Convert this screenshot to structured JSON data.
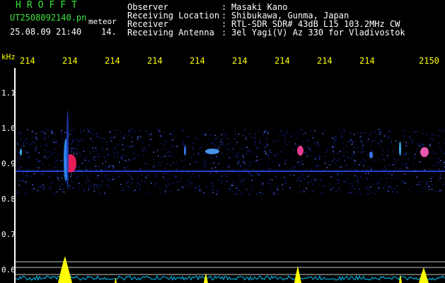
{
  "header": {
    "logo": "HROFFT",
    "filename": "UT2508092140.pn",
    "mode": "meteor",
    "timestamp": "25.08.09 21:40",
    "count": "14.",
    "fields": [
      {
        "label": "Observer",
        "value": "Masaki Kano"
      },
      {
        "label": "Receiving Location",
        "value": "Shibukawa, Gunma, Japan"
      },
      {
        "label": "Receiver",
        "value": "RTL-SDR SDR# 43dB L15 103.2MHz CW"
      },
      {
        "label": "Receiving Antenna",
        "value": "3el Yagi(V) Az 330 for Vladivostok"
      }
    ],
    "colon": ":"
  },
  "axes": {
    "y_unit": "kHz",
    "x_ticks": [
      "214",
      "214",
      "214",
      "214",
      "214",
      "214",
      "214",
      "214",
      "214",
      "2150"
    ],
    "y_ticks": [
      "1.1",
      "1.0",
      "0.9",
      "0.8",
      "0.7",
      "0.6"
    ]
  },
  "colors": {
    "text_green": "#3de43d",
    "text_white": "#ffffff",
    "text_yellow": "#ffff00",
    "trace_cyan": "#00c8ff",
    "trace_yellow": "#ffff00",
    "echo_red": "#ff2060",
    "background": "#000000"
  }
}
